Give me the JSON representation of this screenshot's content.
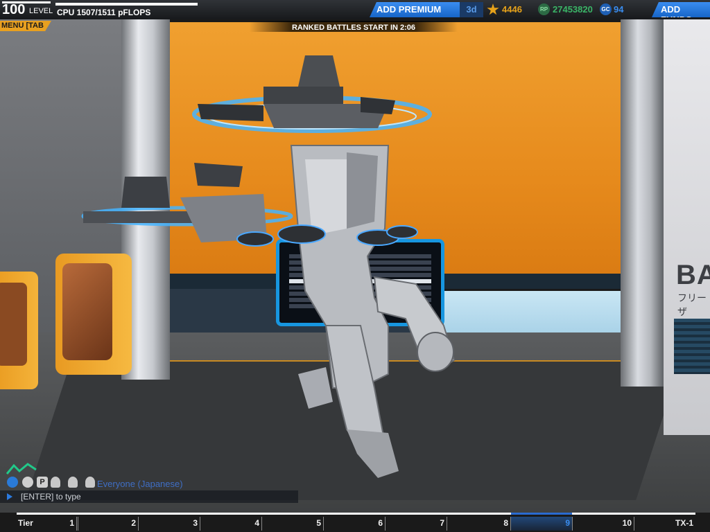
{
  "hud": {
    "level_value": "100",
    "level_label": "LEVEL",
    "cpu_text": "CPU 1507/1511 pFLOPS",
    "cpu_used": 1507,
    "cpu_max": 1511,
    "premium_button": "ADD PREMIUM",
    "premium_days": "3d",
    "tech_points": "4446",
    "robits": "27453820",
    "robits_icon_label": "RP",
    "galaxy_coins": "94",
    "galaxy_coins_icon_label": "GC",
    "funds_button": "ADD FUNDS",
    "menu_tab": "MENU [TAB",
    "ranked_countdown": "RANKED BATTLES START IN 2:06"
  },
  "garage": {
    "bay_sign": "BAY",
    "bay_sub": "フリーザ"
  },
  "chat": {
    "channel": "Everyone (Japanese)",
    "input_hint": "[ENTER] to type",
    "filter_p_label": "P",
    "icons": [
      "globe-icon",
      "person-icon",
      "p-icon",
      "party-1-icon",
      "party-2-icon",
      "party-3-icon"
    ]
  },
  "tiers": {
    "items": [
      "Tier",
      "1",
      "2",
      "3",
      "4",
      "5",
      "6",
      "7",
      "8",
      "9",
      "10",
      "TX-1"
    ],
    "current": "9"
  },
  "colors": {
    "accent_blue": "#3a8df0",
    "tech_points_gold": "#e6a21a",
    "robits_green": "#3ab466",
    "menu_orange": "#e8a020"
  }
}
